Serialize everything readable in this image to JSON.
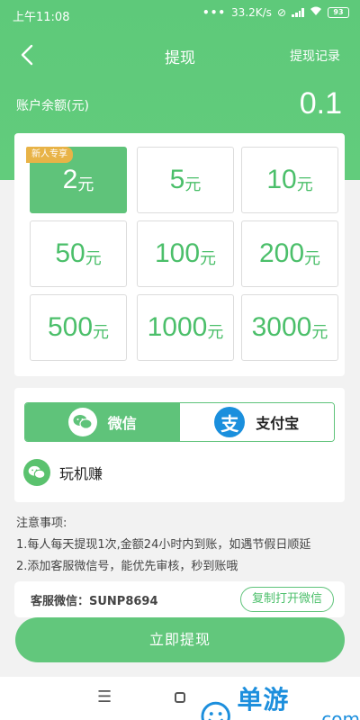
{
  "status_bar": {
    "time": "上午11:08",
    "net_speed": "33.2K/s",
    "battery": "93"
  },
  "header": {
    "back_icon": "chevron-left-icon",
    "title": "提现",
    "record_link": "提现记录"
  },
  "balance": {
    "label": "账户余额(元)",
    "value": "0.1"
  },
  "amounts": {
    "unit": "元",
    "badge": "新人专享",
    "selected_index": 0,
    "items": [
      {
        "num": "2"
      },
      {
        "num": "5"
      },
      {
        "num": "10"
      },
      {
        "num": "50"
      },
      {
        "num": "100"
      },
      {
        "num": "200"
      },
      {
        "num": "500"
      },
      {
        "num": "1000"
      },
      {
        "num": "3000"
      }
    ]
  },
  "payment": {
    "tabs": [
      {
        "label": "微信",
        "icon": "wechat-icon",
        "active": true
      },
      {
        "label": "支付宝",
        "icon": "alipay-icon",
        "active": false
      }
    ],
    "account_name": "玩机赚"
  },
  "notes": {
    "title": "注意事项:",
    "line1": "1.每人每天提现1次,金额24小时内到账，如遇节假日顺延",
    "line2": "2.添加客服微信号，能优先审核，秒到账哦"
  },
  "service": {
    "text": "客服微信：SUNP8694",
    "copy_button": "复制打开微信"
  },
  "withdraw_button": "立即提现",
  "watermark": {
    "text": "单游网",
    "domain": ".com"
  },
  "colors": {
    "primary_green": "#5fc37a",
    "badge_gold": "#e8b347",
    "alipay_blue": "#1a8fdd"
  }
}
